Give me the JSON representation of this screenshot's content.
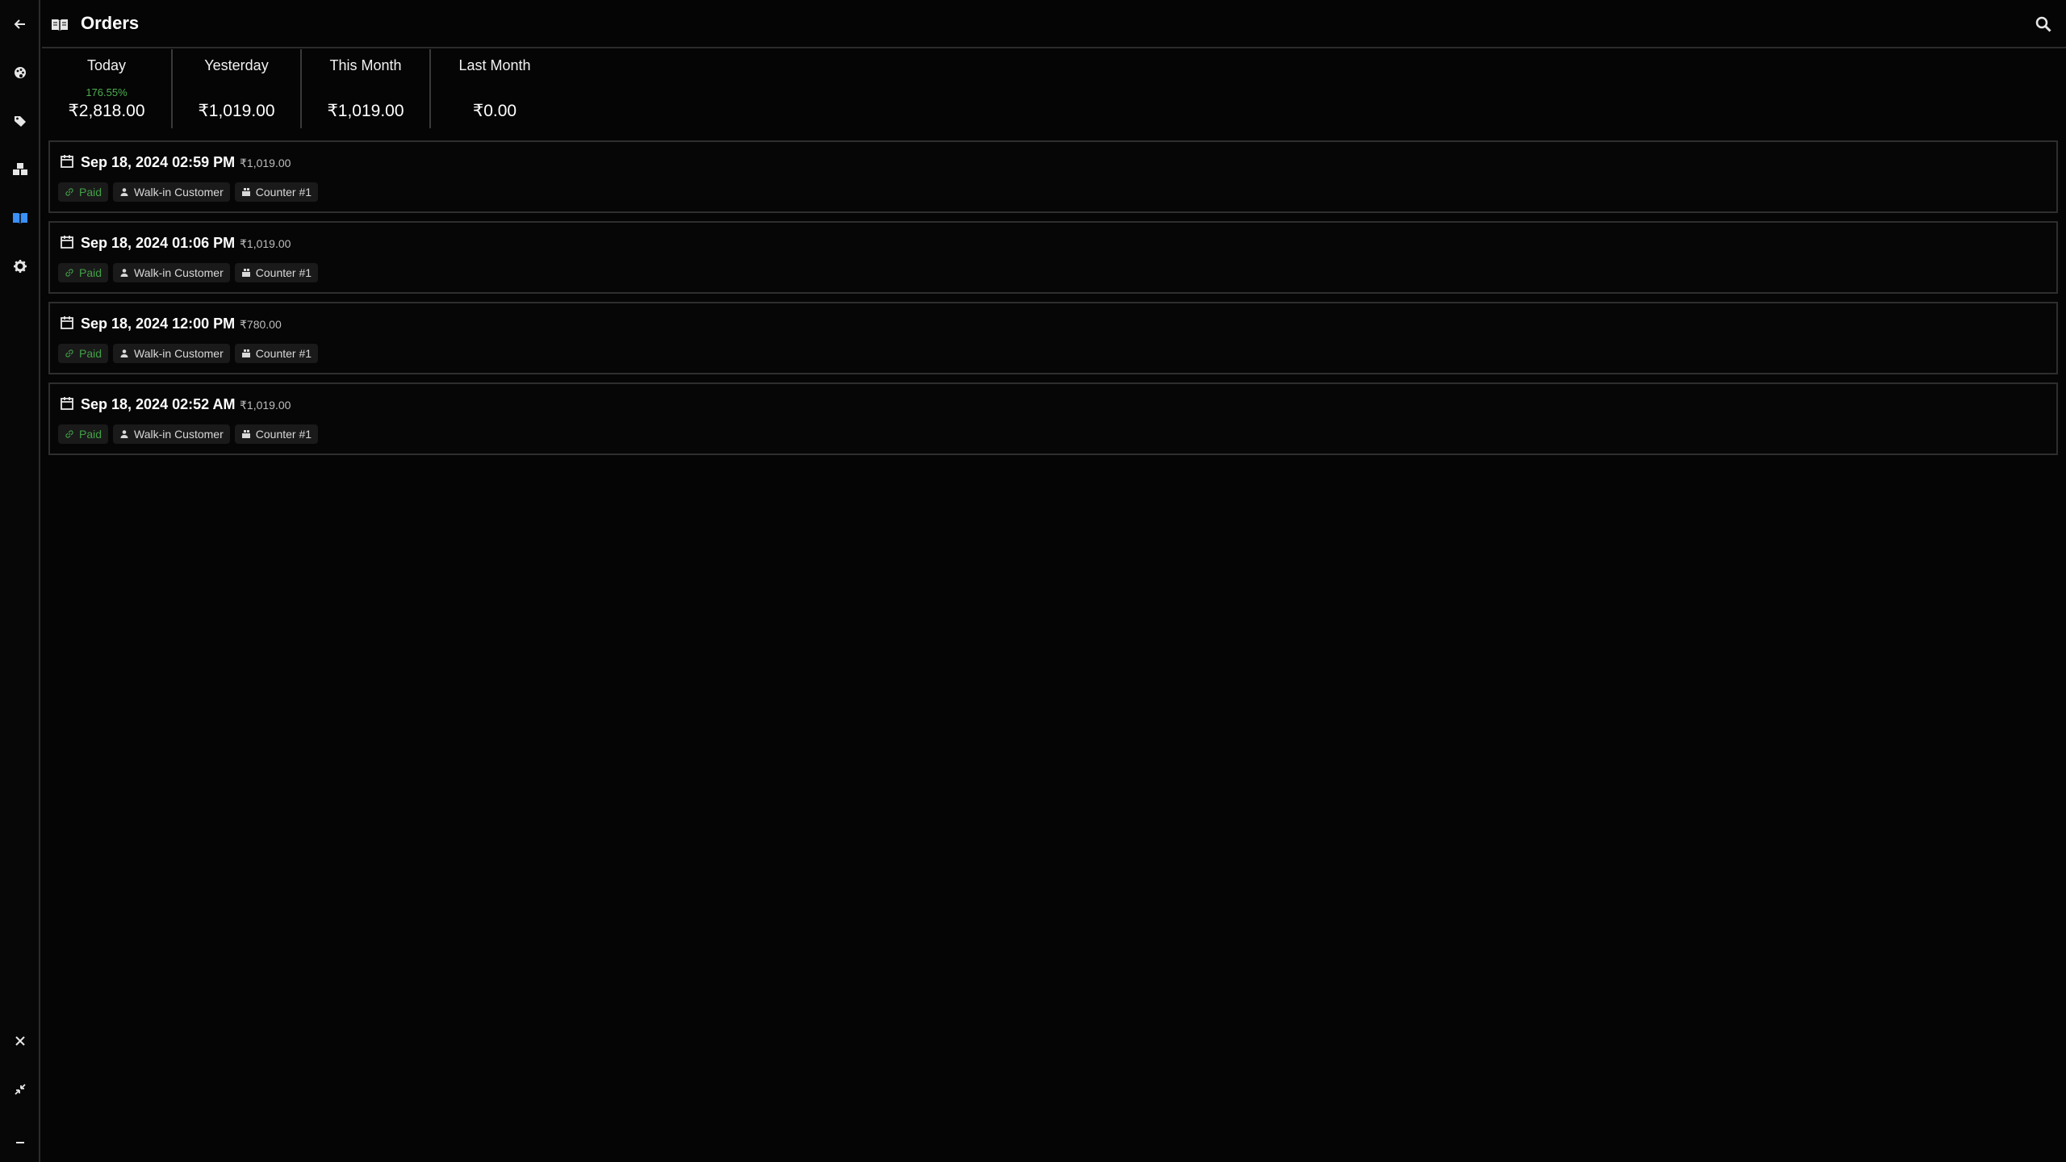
{
  "header": {
    "title": "Orders"
  },
  "stats": [
    {
      "label": "Today",
      "pct": "176.55%",
      "value": "₹2,818.00"
    },
    {
      "label": "Yesterday",
      "pct": "",
      "value": "₹1,019.00"
    },
    {
      "label": "This Month",
      "pct": "",
      "value": "₹1,019.00"
    },
    {
      "label": "Last Month",
      "pct": "",
      "value": "₹0.00"
    }
  ],
  "orders": [
    {
      "date": "Sep 18, 2024 02:59 PM",
      "amount": "₹1,019.00",
      "status": "Paid",
      "customer": "Walk-in Customer",
      "counter": "Counter #1"
    },
    {
      "date": "Sep 18, 2024 01:06 PM",
      "amount": "₹1,019.00",
      "status": "Paid",
      "customer": "Walk-in Customer",
      "counter": "Counter #1"
    },
    {
      "date": "Sep 18, 2024 12:00 PM",
      "amount": "₹780.00",
      "status": "Paid",
      "customer": "Walk-in Customer",
      "counter": "Counter #1"
    },
    {
      "date": "Sep 18, 2024 02:52 AM",
      "amount": "₹1,019.00",
      "status": "Paid",
      "customer": "Walk-in Customer",
      "counter": "Counter #1"
    }
  ],
  "icons": {
    "sidebar": [
      "back-arrow-icon",
      "palette-icon",
      "tag-icon",
      "cubes-icon",
      "book-icon",
      "gear-icon",
      "close-icon",
      "collapse-icon",
      "minimize-icon"
    ],
    "accent": "#3b8ff6",
    "paid_color": "#43a047"
  }
}
